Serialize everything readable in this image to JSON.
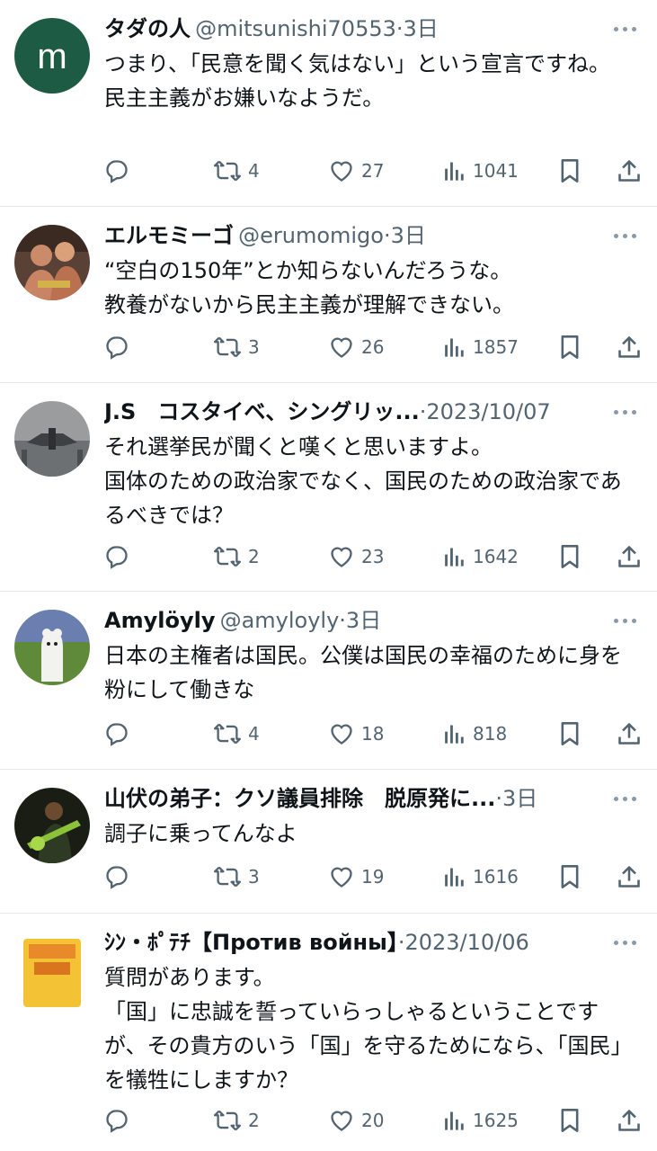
{
  "tweets": [
    {
      "name": "タダの人",
      "handle": "@mitsunishi70553",
      "time": "3日",
      "body": "つまり、「民意を聞く気はない」という宣言ですね。\n民主主義がお嫌いなようだ。",
      "avatar_letter": "m",
      "avatar_color": "#1e5b45",
      "retweets": "4",
      "likes": "27",
      "views": "1041"
    },
    {
      "name": "エルモミーゴ",
      "handle": "@erumomigo",
      "time": "3日",
      "body": "“空白の150年”とか知らないんだろうな。\n教養がないから民主主義が理解できない。",
      "retweets": "3",
      "likes": "26",
      "views": "1857"
    },
    {
      "name": "J.S　コスタイベ、シングリッ...",
      "handle": "",
      "time": "2023/10/07",
      "body": "それ選挙民が聞くと嘆くと思いますよ。\n国体のための政治家でなく、国民のための政治家であるべきでは？",
      "retweets": "2",
      "likes": "23",
      "views": "1642"
    },
    {
      "name": "Amylöyly",
      "handle": "@amyloyly",
      "time": "3日",
      "body": "日本の主権者は国民。公僕は国民の幸福のために身を粉にして働きな",
      "retweets": "4",
      "likes": "18",
      "views": "818"
    },
    {
      "name": "山伏の弟子：クソ議員排除　脱原発に...",
      "handle": "",
      "time": "3日",
      "body": "調子に乗ってんなよ",
      "retweets": "3",
      "likes": "19",
      "views": "1616"
    },
    {
      "name": "ｼﾝ・ﾎﾟﾃﾁ【Против войны】",
      "handle": "",
      "time": "2023/10/06",
      "body": "質問があります。\n「国」に忠誠を誓っていらっしゃるということですが、その貴方のいう「国」を守るためになら、「国民」を犠牲にしますか？",
      "retweets": "2",
      "likes": "20",
      "views": "1625"
    }
  ]
}
